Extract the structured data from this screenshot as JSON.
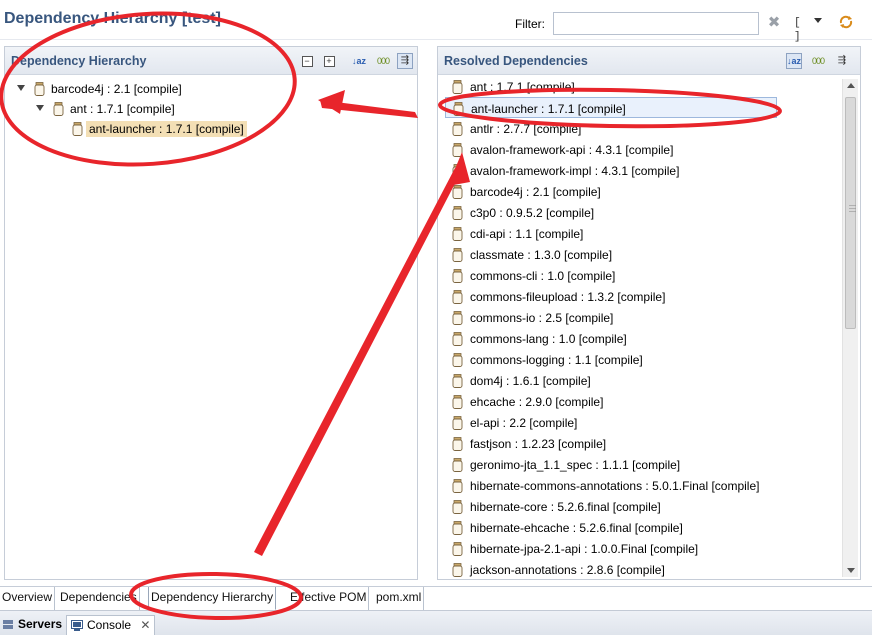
{
  "header": {
    "title": "Dependency Hierarchy [test]",
    "filter_label": "Filter:",
    "filter_value": ""
  },
  "hierarchy_panel": {
    "title": "Dependency Hierarchy",
    "tree": [
      {
        "label": "barcode4j : 2.1 [compile]",
        "depth": 0,
        "expanded": true,
        "highlighted": false
      },
      {
        "label": "ant : 1.7.1 [compile]",
        "depth": 1,
        "expanded": true,
        "highlighted": false
      },
      {
        "label": "ant-launcher : 1.7.1 [compile]",
        "depth": 2,
        "expanded": false,
        "highlighted": true
      }
    ]
  },
  "resolved_panel": {
    "title": "Resolved Dependencies",
    "selected_index": 1,
    "items": [
      "ant : 1.7.1 [compile]",
      "ant-launcher : 1.7.1 [compile]",
      "antlr : 2.7.7 [compile]",
      "avalon-framework-api : 4.3.1 [compile]",
      "avalon-framework-impl : 4.3.1 [compile]",
      "barcode4j : 2.1 [compile]",
      "c3p0 : 0.9.5.2 [compile]",
      "cdi-api : 1.1 [compile]",
      "classmate : 1.3.0 [compile]",
      "commons-cli : 1.0 [compile]",
      "commons-fileupload : 1.3.2 [compile]",
      "commons-io : 2.5 [compile]",
      "commons-lang : 1.0 [compile]",
      "commons-logging : 1.1 [compile]",
      "dom4j : 1.6.1 [compile]",
      "ehcache : 2.9.0 [compile]",
      "el-api : 2.2 [compile]",
      "fastjson : 1.2.23 [compile]",
      "geronimo-jta_1.1_spec : 1.1.1 [compile]",
      "hibernate-commons-annotations : 5.0.1.Final [compile]",
      "hibernate-core : 5.2.6.final [compile]",
      "hibernate-ehcache : 5.2.6.final [compile]",
      "hibernate-jpa-2.1-api : 1.0.0.Final [compile]",
      "jackson-annotations : 2.8.6 [compile]"
    ]
  },
  "editor_tabs": [
    {
      "label": "Overview",
      "active": false
    },
    {
      "label": "Dependencies",
      "active": false
    },
    {
      "label": "Dependency Hierarchy",
      "active": true
    },
    {
      "label": "Effective POM",
      "active": false
    },
    {
      "label": "pom.xml",
      "active": false
    }
  ],
  "views": [
    {
      "label": "Servers",
      "icon": "servers-icon",
      "bold": true
    },
    {
      "label": "Console",
      "icon": "console-icon",
      "bold": false
    }
  ],
  "colors": {
    "title": "#38567e",
    "annotation": "#e8252b",
    "tree_highlight": "#f3dfb5"
  }
}
